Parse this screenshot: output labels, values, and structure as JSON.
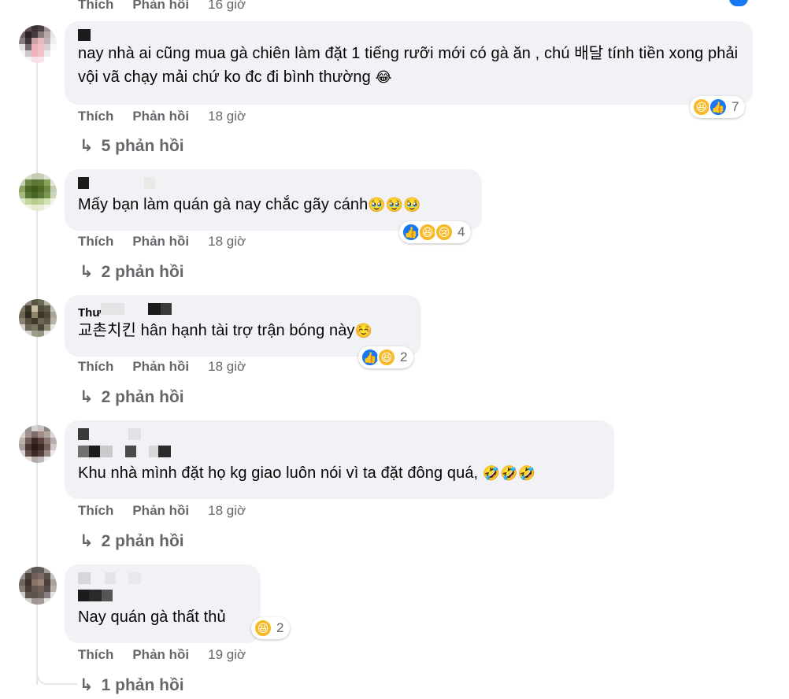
{
  "labels": {
    "like": "Thích",
    "reply": "Phản hồi"
  },
  "top": {
    "time": "16 giờ"
  },
  "comments": [
    {
      "text": "nay nhà ai cũng mua gà chiên làm đặt 1 tiếng rưỡi mới có gà ăn , chú 배달 tính tiền xong phải vội vã chạy mải chứ ko đc đi bình thường",
      "emoji": "😂",
      "time": "18 giờ",
      "reaction_count": "7",
      "reactions": [
        "haha-icon",
        "like-icon"
      ],
      "replies": "5 phản hồi"
    },
    {
      "text": "Mấy bạn làm quán gà nay chắc gãy cánh",
      "emoji": "🥹🥹🥹",
      "time": "18 giờ",
      "reaction_count": "4",
      "reactions": [
        "like-icon",
        "haha-icon",
        "sad-icon"
      ],
      "replies": "2 phản hồi"
    },
    {
      "name_partial": "Thư",
      "text": "교촌치킨 hân hạnh tài trợ trận bóng này",
      "emoji": "☺️",
      "time": "18 giờ",
      "reaction_count": "2",
      "reactions": [
        "like-icon",
        "haha-icon"
      ],
      "replies": "2 phản hồi"
    },
    {
      "text": "Khu nhà mình đặt họ kg giao luôn nói vì ta đặt đông quá,",
      "emoji": "🤣🤣🤣",
      "time": "18 giờ",
      "reaction_count": "",
      "reactions": [],
      "replies": "2 phản hồi"
    },
    {
      "text": "Nay quán gà thất thủ",
      "emoji": "",
      "time": "19 giờ",
      "reaction_count": "2",
      "reactions": [
        "haha-icon"
      ],
      "replies": "1 phản hồi"
    }
  ],
  "colors": {
    "bubble": "#f0f2f5",
    "meta": "#65676b",
    "like": "#1877f2",
    "haha": "#f7b928"
  }
}
